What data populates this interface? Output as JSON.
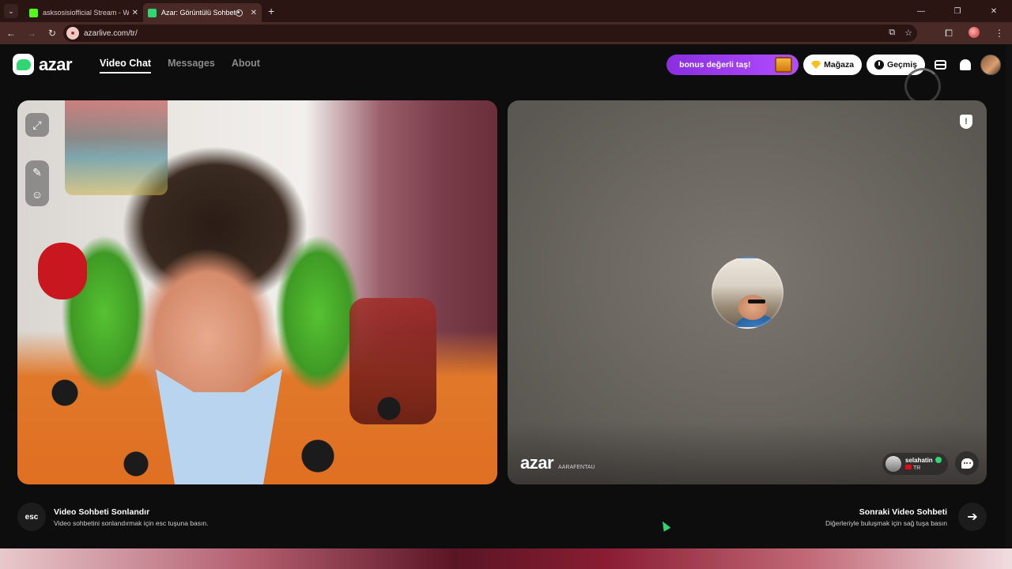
{
  "browser": {
    "tabs": [
      {
        "title": "asksosisiofficial Stream - Watch",
        "favicon_color": "#53fc18",
        "active": false
      },
      {
        "title": "Azar: Görüntülü Sohbet & Y",
        "favicon_color": "#2fd671",
        "active": true
      }
    ],
    "url": "azarlive.com/tr/",
    "new_tab_label": "+"
  },
  "app": {
    "logo_text": "azar",
    "nav": [
      "Video Chat",
      "Messages",
      "About"
    ],
    "active_nav": "Video Chat",
    "bonus_label": "bonus değerli taş!",
    "store_label": "Mağaza",
    "history_label": "Geçmiş"
  },
  "peer": {
    "watermark": "azar",
    "watermark_id": "AARAFENTAU",
    "name": "selahatin",
    "country": "TR"
  },
  "hints": {
    "esc_key": "esc",
    "end_title": "Video Sohbeti Sonlandır",
    "end_sub": "Video sohbetini sonlandırmak için esc tuşuna basın.",
    "next_title": "Sonraki Video Sohbeti",
    "next_sub": "Diğerleriyle buluşmak için sağ tuşa basın"
  },
  "colors": {
    "accent_green": "#2fd671",
    "bonus_purple": "#8a2ee0",
    "chrome_bg": "#2b1513"
  },
  "icons": [
    "expand-icon",
    "magic-wand-icon",
    "face-filter-icon",
    "report-shield-icon",
    "chat-bubble-icon",
    "arrow-right-icon",
    "bell-icon",
    "inbox-icon",
    "clock-icon",
    "gem-icon"
  ]
}
